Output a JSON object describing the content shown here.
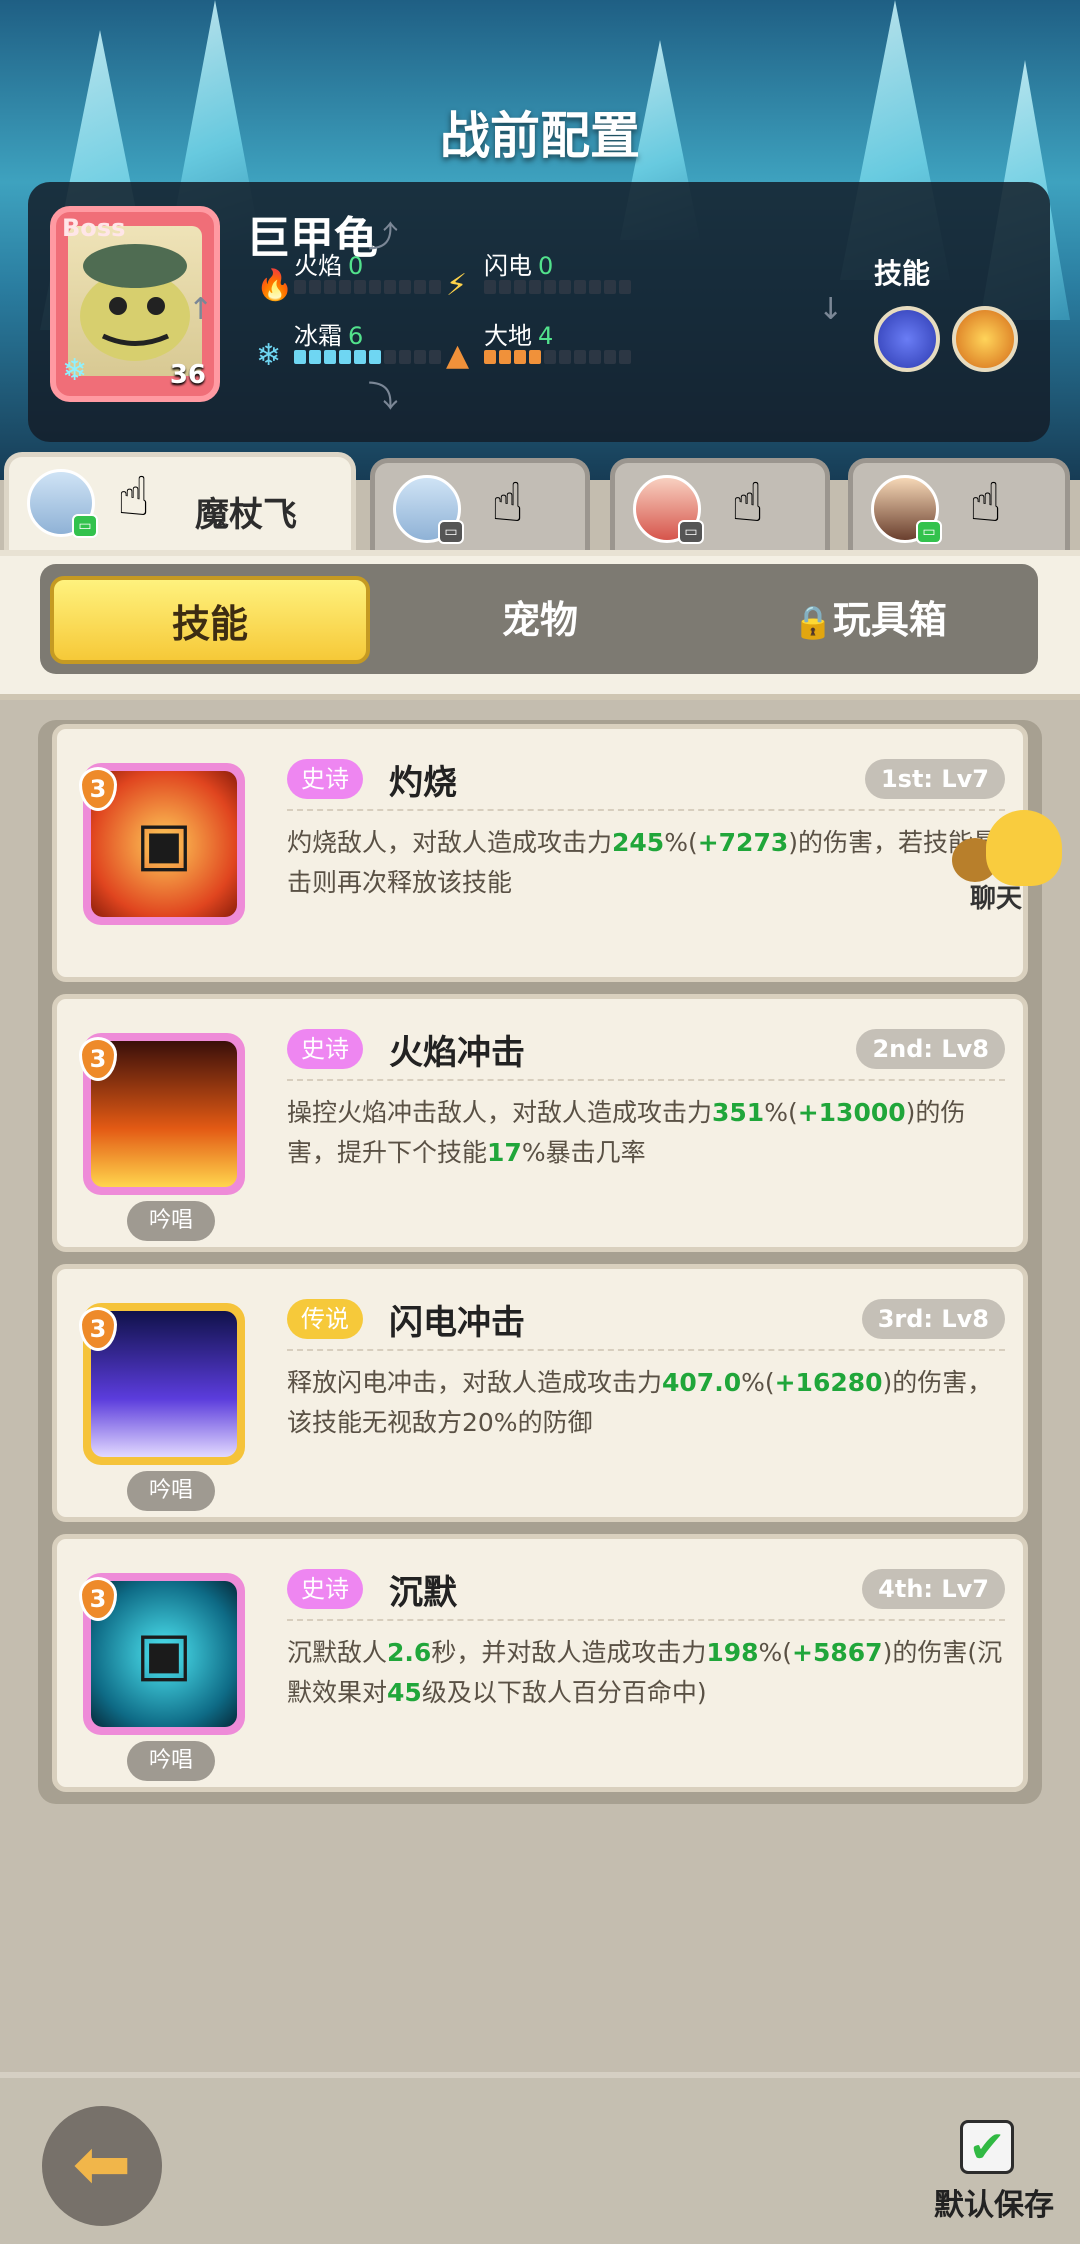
{
  "header": {
    "title": "战前配置"
  },
  "boss": {
    "tag": "Boss",
    "name": "巨甲龟",
    "level": "36",
    "skills_label": "技能",
    "stats": [
      {
        "name": "火焰",
        "value": "0",
        "filled": 0,
        "total": 10,
        "color": "#ff6b3c",
        "icon": "fire-icon"
      },
      {
        "name": "闪电",
        "value": "0",
        "filled": 0,
        "total": 10,
        "color": "#ffd34a",
        "icon": "lightning-icon"
      },
      {
        "name": "冰霜",
        "value": "6",
        "filled": 6,
        "total": 10,
        "color": "#6fd6f2",
        "icon": "snowflake-icon"
      },
      {
        "name": "大地",
        "value": "4",
        "filled": 4,
        "total": 10,
        "color": "#f0913a",
        "icon": "mountain-icon"
      }
    ]
  },
  "hero_tabs": [
    {
      "name": "魔杖飞",
      "active": true
    },
    {
      "name": "",
      "active": false
    },
    {
      "name": "",
      "active": false
    },
    {
      "name": "",
      "active": false
    }
  ],
  "sub_tabs": [
    {
      "label": "技能",
      "active": true
    },
    {
      "label": "宠物",
      "active": false
    },
    {
      "label": "玩具箱",
      "active": false,
      "locked": true
    }
  ],
  "skills": [
    {
      "rank": "3",
      "rarity": "史诗",
      "name": "灼烧",
      "level": "1st: Lv7",
      "desc_html": "灼烧敌人，对敌人造成攻击力<span class='g'>245</span>%(<span class='g'>+7273</span>)的伤害，若技能暴击则再次释放该技能",
      "chant": ""
    },
    {
      "rank": "3",
      "rarity": "史诗",
      "name": "火焰冲击",
      "level": "2nd: Lv8",
      "desc_html": "操控火焰冲击敌人，对敌人造成攻击力<span class='g'>351</span>%(<span class='g'>+13000</span>)的伤害，提升下个技能<span class='g'>17</span>%暴击几率",
      "chant": "吟唱"
    },
    {
      "rank": "3",
      "rarity": "传说",
      "name": "闪电冲击",
      "level": "3rd: Lv8",
      "desc_html": "释放闪电冲击，对敌人造成攻击力<span class='g'>407.0</span>%(<span class='g'>+16280</span>)的伤害，该技能无视敌方20%的防御",
      "chant": "吟唱"
    },
    {
      "rank": "3",
      "rarity": "史诗",
      "name": "沉默",
      "level": "4th: Lv7",
      "desc_html": "沉默敌人<span class='g'>2.6</span>秒，并对敌人造成攻击力<span class='g'>198</span>%(<span class='g'>+5867</span>)的伤害(沉默效果对<span class='g'>45</span>级及以下敌人百分百命中)",
      "chant": "吟唱"
    }
  ],
  "chat": {
    "label": "聊天"
  },
  "footer": {
    "save_label": "默认保存",
    "back_icon": "back-arrow-icon",
    "save_checked": true
  }
}
